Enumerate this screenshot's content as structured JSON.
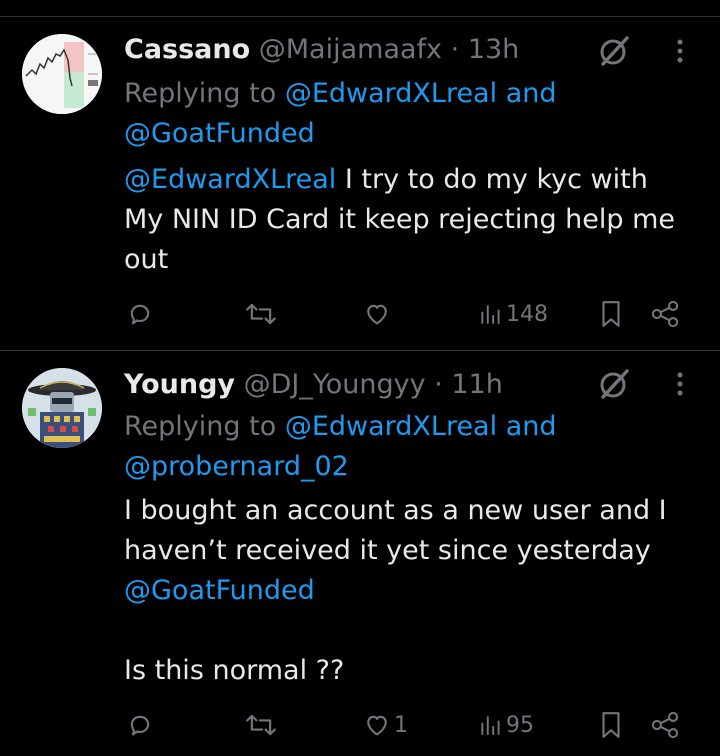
{
  "colors": {
    "background": "#000000",
    "text_primary": "#e7e9ea",
    "text_muted": "#71767b",
    "link": "#1d9bf0",
    "divider": "#2f3336"
  },
  "tweets": [
    {
      "name": "Cassano",
      "handle": "@Maijamaafx",
      "separator": "·",
      "time": "13h",
      "replying_prefix": "Replying to",
      "replying_to_1": "@EdwardXLreal",
      "replying_and": "and",
      "replying_to_2": "@GoatFunded",
      "body_mention": "@EdwardXLreal",
      "body_line_1": " I try to do my kyc with",
      "body_line_2": "My NIN ID Card it keep rejecting help me",
      "body_line_3": "out",
      "views": "148",
      "likes": "",
      "icons": [
        "reply-icon",
        "retweet-icon",
        "like-icon",
        "views-icon",
        "bookmark-icon",
        "share-icon",
        "grok-icon",
        "more-icon"
      ]
    },
    {
      "name": "Youngy",
      "handle": "@DJ_Youngyy",
      "separator": "·",
      "time": "11h",
      "replying_prefix": "Replying to",
      "replying_to_1": "@EdwardXLreal",
      "replying_and": "and",
      "replying_to_2": "@probernard_02",
      "body_line_1": "I bought an account as a new user and I",
      "body_line_2": "haven’t received it yet since yesterday",
      "body_mention": "@GoatFunded",
      "body_line_4": "Is this normal ??",
      "likes": "1",
      "views": "95",
      "icons": [
        "reply-icon",
        "retweet-icon",
        "like-icon",
        "views-icon",
        "bookmark-icon",
        "share-icon",
        "grok-icon",
        "more-icon"
      ]
    }
  ]
}
